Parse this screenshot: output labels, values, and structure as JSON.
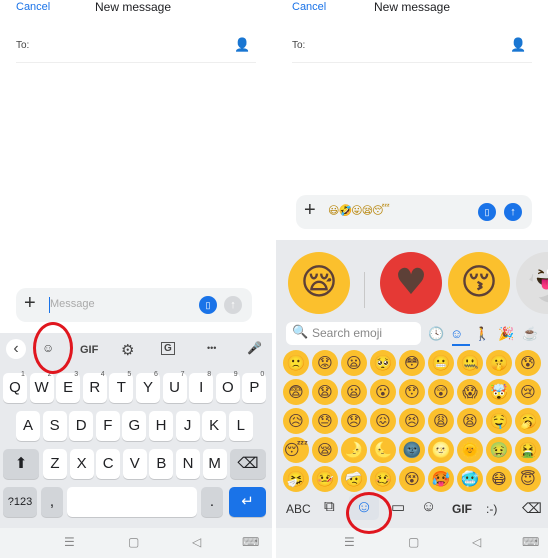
{
  "header": {
    "cancel": "Cancel",
    "title": "New message",
    "to": "To:"
  },
  "left": {
    "message_placeholder": "Message",
    "toolbar": {
      "back": "‹",
      "sticker": "☺",
      "gif": "GIF",
      "settings": "⚙",
      "translate": "G",
      "more": "•••",
      "mic": "🎤"
    },
    "rows": [
      [
        {
          "k": "Q",
          "n": "1"
        },
        {
          "k": "W",
          "n": "2"
        },
        {
          "k": "E",
          "n": "3"
        },
        {
          "k": "R",
          "n": "4"
        },
        {
          "k": "T",
          "n": "5"
        },
        {
          "k": "Y",
          "n": "6"
        },
        {
          "k": "U",
          "n": "7"
        },
        {
          "k": "I",
          "n": "8"
        },
        {
          "k": "O",
          "n": "9"
        },
        {
          "k": "P",
          "n": "0"
        }
      ],
      [
        "A",
        "S",
        "D",
        "F",
        "G",
        "H",
        "J",
        "K",
        "L"
      ],
      [
        "Z",
        "X",
        "C",
        "V",
        "B",
        "N",
        "M"
      ]
    ],
    "shift": "⬆",
    "backspace": "⌫",
    "symbols": "?123",
    "comma": ",",
    "period": ".",
    "enter": "↵"
  },
  "right": {
    "message_value": "😃🤣😛😪😴",
    "stickers": [
      "😪",
      "♥",
      "😚",
      "👻"
    ],
    "search_placeholder": "Search emoji",
    "categories": [
      "recent-icon",
      "smileys-icon",
      "people-icon",
      "activities-icon",
      "objects-icon"
    ],
    "emoji_grid": [
      [
        "🙁",
        "😟",
        "😦",
        "🥺",
        "😳",
        "😬",
        "🤐",
        "🤫",
        "😰"
      ],
      [
        "😨",
        "😧",
        "😦",
        "😮",
        "😯",
        "😲",
        "😱",
        "🤯",
        "😢"
      ],
      [
        "😥",
        "😓",
        "😞",
        "😖",
        "😣",
        "😩",
        "😫",
        "🤤",
        "🥱"
      ],
      [
        "😴",
        "😪",
        "🌛",
        "🌜",
        "🌚",
        "🌝",
        "🌞",
        "🤢",
        "🤮"
      ],
      [
        "🤧",
        "🤒",
        "🤕",
        "🥴",
        "😵",
        "🥵",
        "🥶",
        "😷",
        "😇"
      ]
    ],
    "bottom": {
      "abc": "ABC",
      "gif": "GIF",
      "emoticon": ":-)"
    }
  },
  "colors": {
    "accent": "#1a73e8",
    "highlight": "#e0161e",
    "keyboard_bg": "#e8eaed"
  }
}
